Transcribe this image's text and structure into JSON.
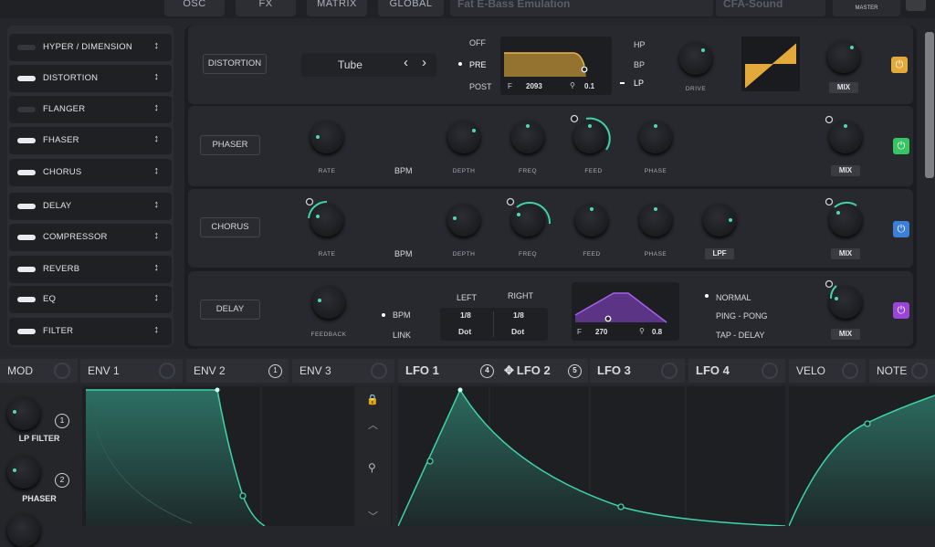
{
  "top": {
    "tabs": [
      "OSC",
      "FX",
      "MATRIX",
      "GLOBAL"
    ],
    "preset_name": "Fat E-Bass Emulation",
    "author": "CFA-Sound",
    "master_label": "MASTER"
  },
  "fx_list": [
    {
      "label": "HYPER / DIMENSION",
      "on": false
    },
    {
      "label": "DISTORTION",
      "on": true
    },
    {
      "label": "FLANGER",
      "on": false
    },
    {
      "label": "FHASER",
      "on": true
    },
    {
      "label": "CHORUS",
      "on": true
    },
    {
      "label": "DELAY",
      "on": true
    },
    {
      "label": "COMPRESSOR",
      "on": true
    },
    {
      "label": "REVERB",
      "on": true
    },
    {
      "label": "EQ",
      "on": true
    },
    {
      "label": "FILTER",
      "on": true
    }
  ],
  "distortion": {
    "name": "DISTORTION",
    "type": "Tube",
    "routing": [
      "OFF",
      "PRE",
      "POST"
    ],
    "routing_selected": "PRE",
    "filter_types": [
      "HP",
      "BP",
      "LP"
    ],
    "filter_selected": "LP",
    "freq_label": "F",
    "freq_value": "2093",
    "q_value": "0.1",
    "drive_label": "DRIVE",
    "mix_label": "MIX",
    "accent": "#e3a93a"
  },
  "phaser": {
    "name": "PHASER",
    "bpm_label": "BPM",
    "knobs": [
      "RATE",
      "DEPTH",
      "FREQ",
      "FEED",
      "PHASE"
    ],
    "mix_label": "MIX",
    "accent": "#37c463"
  },
  "chorus": {
    "name": "CHORUS",
    "bpm_label": "BPM",
    "knobs": [
      "RATE",
      "DEPTH",
      "FREQ",
      "FEED",
      "PHASE"
    ],
    "lpf_label": "LPF",
    "mix_label": "MIX",
    "accent": "#3c7fd6"
  },
  "delay": {
    "name": "DELAY",
    "feedback_label": "FEEDBACK",
    "bpm_label": "BPM",
    "link_label": "LINK",
    "left_label": "LEFT",
    "right_label": "RIGHT",
    "left_time": "1/8",
    "left_mode": "Dot",
    "right_time": "1/8",
    "right_mode": "Dot",
    "freq_label": "F",
    "freq_value": "270",
    "q_value": "0.8",
    "modes": [
      "NORMAL",
      "PING - PONG",
      "TAP - DELAY"
    ],
    "mode_selected": "NORMAL",
    "mix_label": "MIX",
    "accent": "#9b45d8"
  },
  "mod_tabs": [
    {
      "label": "MOD",
      "badge": ""
    },
    {
      "label": "ENV 1",
      "badge": ""
    },
    {
      "label": "ENV 2",
      "badge": "1"
    },
    {
      "label": "ENV 3",
      "badge": ""
    },
    {
      "label": "LFO 1",
      "badge": "4"
    },
    {
      "label": "LFO 2",
      "badge": "5"
    },
    {
      "label": "LFO 3",
      "badge": ""
    },
    {
      "label": "LFO 4",
      "badge": ""
    },
    {
      "label": "VELO",
      "badge": ""
    },
    {
      "label": "NOTE",
      "badge": ""
    }
  ],
  "mod_targets": [
    {
      "label": "LP FILTER",
      "badge": "1"
    },
    {
      "label": "PHASER",
      "badge": "2"
    }
  ],
  "colors": {
    "envelope": "#3fd3a8"
  }
}
